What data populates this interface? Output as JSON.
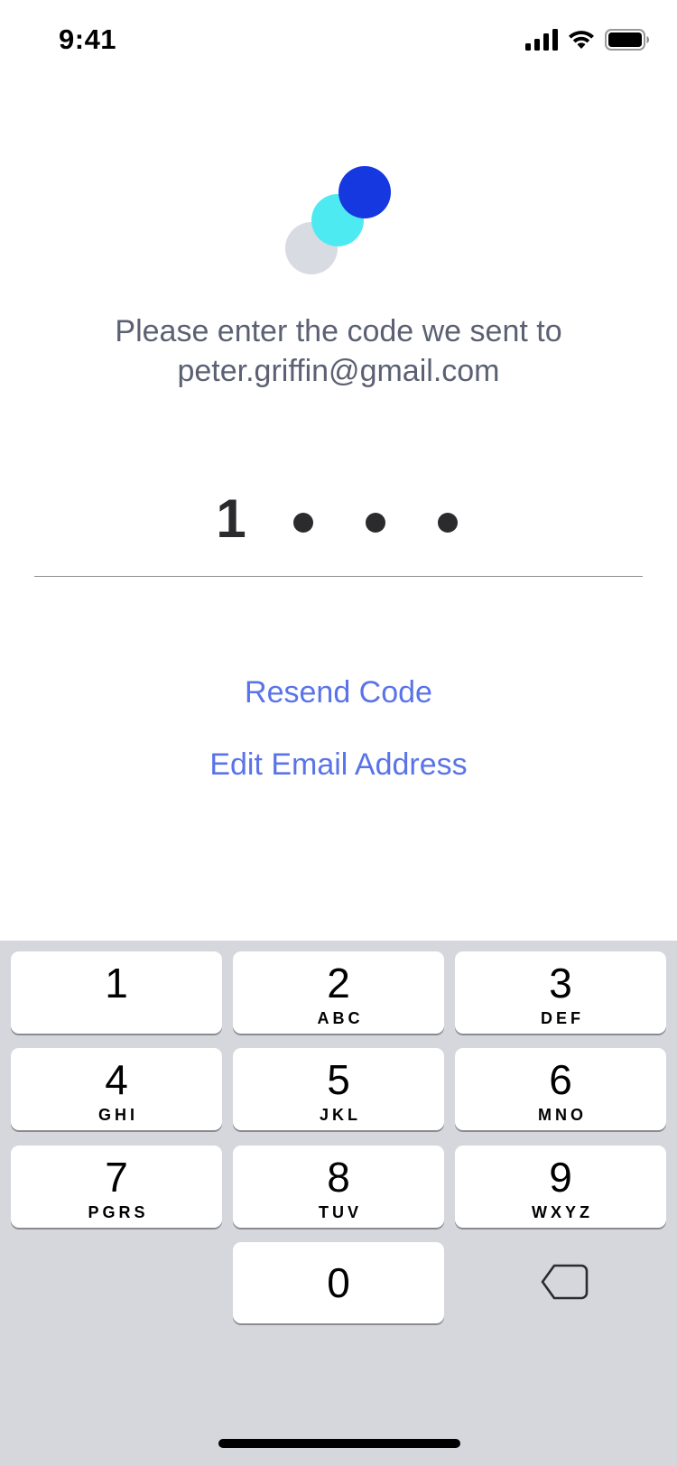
{
  "status_bar": {
    "time": "9:41"
  },
  "prompt": {
    "line1": "Please enter the code we sent to",
    "line2": "peter.griffin@gmail.com"
  },
  "code": {
    "entered_digit": "1",
    "remaining_masked": 3
  },
  "links": {
    "resend": "Resend Code",
    "edit_email": "Edit Email Address"
  },
  "keyboard": {
    "keys": [
      {
        "num": "1",
        "letters": ""
      },
      {
        "num": "2",
        "letters": "ABC"
      },
      {
        "num": "3",
        "letters": "DEF"
      },
      {
        "num": "4",
        "letters": "GHI"
      },
      {
        "num": "5",
        "letters": "JKL"
      },
      {
        "num": "6",
        "letters": "MNO"
      },
      {
        "num": "7",
        "letters": "PGRS"
      },
      {
        "num": "8",
        "letters": "TUV"
      },
      {
        "num": "9",
        "letters": "WXYZ"
      },
      {
        "num": "0",
        "letters": ""
      }
    ]
  },
  "colors": {
    "accent_link": "#5a73e8",
    "logo_dark_blue": "#1638e0",
    "logo_cyan": "#4eeaf2",
    "logo_gray": "#d8dbe2",
    "keyboard_bg": "#d5d7dd"
  }
}
